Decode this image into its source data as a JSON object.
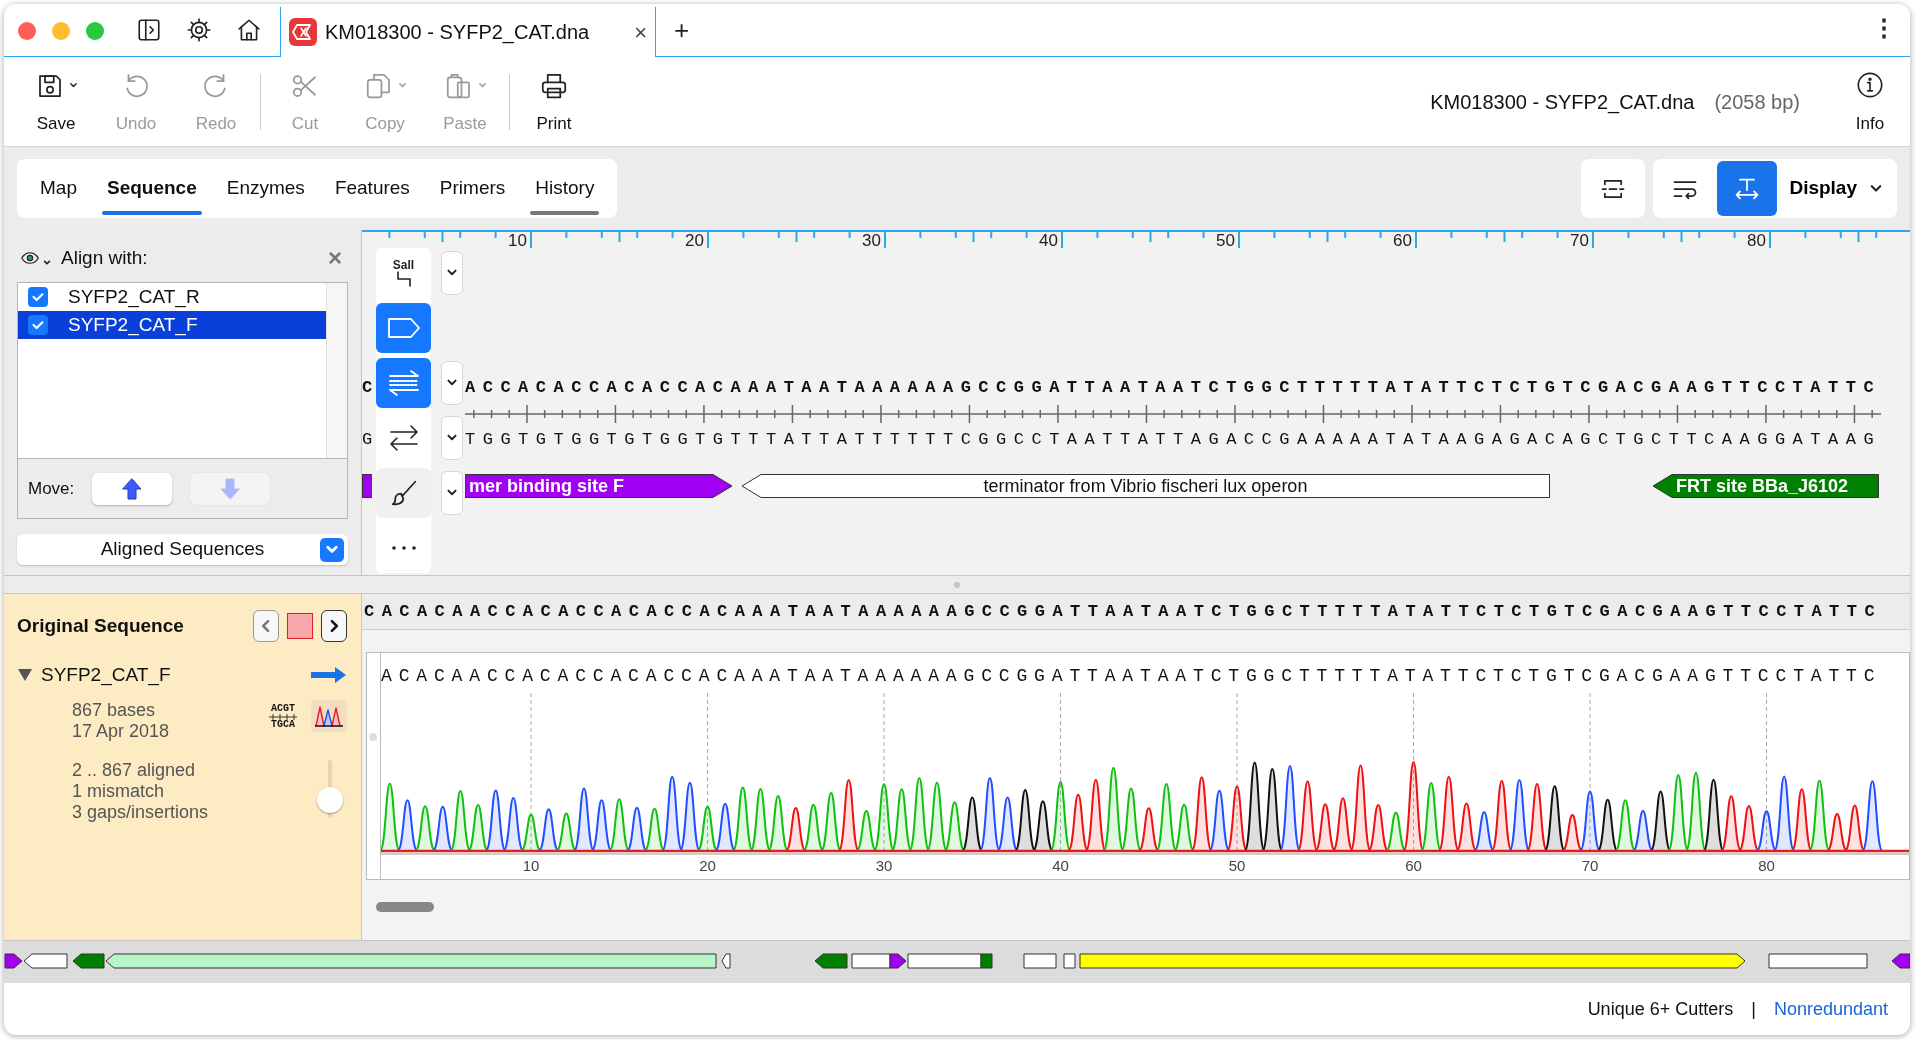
{
  "window": {
    "tab_title": "KM018300 - SYFP2_CAT.dna",
    "tab_close": "×",
    "new_tab": "+",
    "menu": "⋮"
  },
  "toolbar": [
    {
      "label": "Save",
      "kind": "save",
      "disabled": false,
      "dropdown": true
    },
    {
      "label": "Undo",
      "kind": "undo",
      "disabled": true,
      "dropdown": false
    },
    {
      "label": "Redo",
      "kind": "redo",
      "disabled": true,
      "dropdown": false
    },
    {
      "label": "Cut",
      "kind": "cut",
      "disabled": true,
      "dropdown": false
    },
    {
      "label": "Copy",
      "kind": "copy",
      "disabled": true,
      "dropdown": true
    },
    {
      "label": "Paste",
      "kind": "paste",
      "disabled": true,
      "dropdown": true
    },
    {
      "label": "Print",
      "kind": "print",
      "disabled": false,
      "dropdown": false
    }
  ],
  "document": {
    "title": "KM018300 - SYFP2_CAT.dna",
    "length": "(2058 bp)",
    "info": "Info"
  },
  "view_tabs": [
    {
      "label": "Map",
      "selected": false,
      "marked": false
    },
    {
      "label": "Sequence",
      "selected": true,
      "marked": false
    },
    {
      "label": "Enzymes",
      "selected": false,
      "marked": false
    },
    {
      "label": "Features",
      "selected": false,
      "marked": false
    },
    {
      "label": "Primers",
      "selected": false,
      "marked": false
    },
    {
      "label": "History",
      "selected": false,
      "marked": true
    }
  ],
  "view_buttons": [
    {
      "kind": "collapse",
      "selected": false
    },
    {
      "kind": "wrap",
      "selected": false
    },
    {
      "kind": "fit",
      "selected": true
    }
  ],
  "display_menu": "Display",
  "align_panel": {
    "title": "Align with:",
    "close": "×",
    "items": [
      {
        "label": "SYFP2_CAT_R",
        "checked": true,
        "selected": false
      },
      {
        "label": "SYFP2_CAT_F",
        "checked": true,
        "selected": true
      }
    ],
    "move_label": "Move:",
    "move_up": {
      "disabled": false
    },
    "move_down": {
      "disabled": true
    },
    "select": "Aligned Sequences"
  },
  "tools": [
    {
      "kind": "enzyme",
      "label": "SalI",
      "selected": false,
      "dropdown": true
    },
    {
      "kind": "feature",
      "selected": true,
      "dropdown": false
    },
    {
      "kind": "strands",
      "selected": true,
      "dropdown": true
    },
    {
      "kind": "arrows",
      "selected": false,
      "dropdown": true
    },
    {
      "kind": "brush",
      "selected": false,
      "dropdown": true
    },
    {
      "kind": "more",
      "selected": false,
      "dropdown": false
    }
  ],
  "sequence": {
    "ruler": [
      "10",
      "20",
      "30",
      "40",
      "50",
      "60",
      "70",
      "80"
    ],
    "top_strand_start": "C",
    "top_strand": "ACCACACCACACCACAAATAATAAAAAAGCCGGATTAATAATCTGGCTTTTTATATTCTCTGTCGACGAAGTTCCTATTC",
    "bottom_strand_start": "G",
    "bottom_strand": "TGGTGTGGTGTGGTGTTTATTATTTTTTCGGCCTAATTATTAGACCGAAAAATATAAGAGACAGCTGCTTCAAGGATAAG",
    "features": [
      {
        "label": "mer binding site F",
        "color": "#a100f2",
        "kind": "arrow-right"
      },
      {
        "label": "terminator from Vibrio fischeri lux operon",
        "color": "#ffffff",
        "kind": "arrow-left"
      },
      {
        "label": "FRT site BBa_J6102",
        "color": "#008000",
        "kind": "arrow-left"
      }
    ]
  },
  "trace_panel": {
    "title": "Original Sequence",
    "read": {
      "name": "SYFP2_CAT_F",
      "expanded": true,
      "details": [
        "867 bases",
        "17 Apr 2018"
      ],
      "stats": [
        "2 .. 867 aligned",
        "1 mismatch",
        "3 gaps/insertions"
      ],
      "icon_top": "ACGT",
      "icon_bottom": "TGCA",
      "zoom": {
        "level": 0.15
      }
    }
  },
  "trace": {
    "consensus": "CACACAACCACACCACACCACAAATAATAAAAAAGCCGGATTAATAATCTGGCTTTTTATATTCTCTGTCGACGAAGTTCCTATTC",
    "called": "ACACAACCACACCACACCACAAATAATAAAAAAGCCGGATTAATAATCTGGCTTTTTATATTCTCTGTCGACGAAGTTCCTATTC",
    "axis": [
      "10",
      "20",
      "30",
      "40",
      "50",
      "60",
      "70",
      "80"
    ]
  },
  "feature_map": [
    {
      "color": "#a100f2",
      "kind": "arrow-right"
    },
    {
      "color": "#ffffff",
      "kind": "arrow-left"
    },
    {
      "color": "#008000",
      "kind": "arrow-left"
    },
    {
      "color": "#b8f5c8",
      "kind": "arrow-left"
    },
    {
      "color": "#ffffff",
      "kind": "arrow-left"
    },
    {
      "color": "#008000",
      "kind": "arrow-left"
    },
    {
      "color": "#ffffff",
      "kind": "block"
    },
    {
      "color": "#a100f2",
      "kind": "arrow-right"
    },
    {
      "color": "#ffffff",
      "kind": "block"
    },
    {
      "color": "#008000",
      "kind": "block"
    },
    {
      "color": "#ffffff",
      "kind": "block"
    },
    {
      "color": "#ffffff",
      "kind": "block"
    },
    {
      "color": "#ffff00",
      "kind": "arrow-right"
    },
    {
      "color": "#ffffff",
      "kind": "block"
    },
    {
      "color": "#a100f2",
      "kind": "arrow-left"
    }
  ],
  "status_bar": {
    "filter": "Unique 6+ Cutters",
    "separator": "|",
    "mode": "Nonredundant"
  }
}
